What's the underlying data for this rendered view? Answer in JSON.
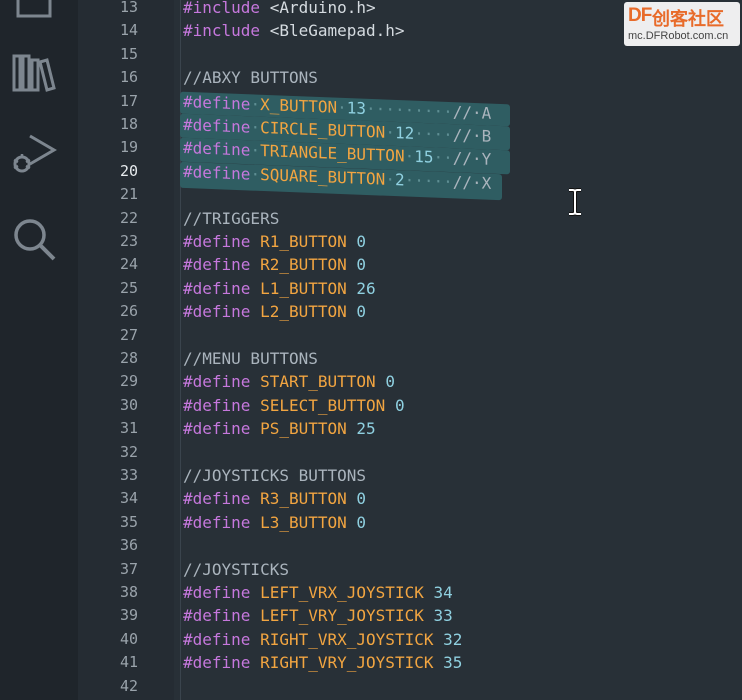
{
  "activity_bar": {
    "icons": [
      "explorer-icon",
      "library-icon",
      "run-debug-icon",
      "search-icon"
    ]
  },
  "gutter": {
    "line_numbers": [
      "13",
      "14",
      "15",
      "16",
      "17",
      "18",
      "19",
      "20",
      "21",
      "22",
      "23",
      "24",
      "25",
      "26",
      "27",
      "28",
      "29",
      "30",
      "31",
      "32",
      "33",
      "34",
      "35",
      "36",
      "37",
      "38",
      "39",
      "40",
      "41",
      "42"
    ],
    "active_line": "20"
  },
  "code": {
    "lines": [
      [
        [
          "kw",
          "#include"
        ],
        [
          "str",
          " <Arduino.h>"
        ]
      ],
      [
        [
          "kw",
          "#include"
        ],
        [
          "str",
          " <BleGamepad.h>"
        ]
      ],
      [],
      [
        [
          "cmt",
          "//ABXY BUTTONS"
        ]
      ],
      [
        [
          "kw",
          "#define"
        ],
        [
          "ws",
          "·"
        ],
        [
          "mac",
          "X_BUTTON"
        ],
        [
          "ws",
          "·"
        ],
        [
          "num",
          "13"
        ],
        [
          "ws",
          "·········"
        ],
        [
          "cmt",
          "//·A"
        ]
      ],
      [
        [
          "kw",
          "#define"
        ],
        [
          "ws",
          "·"
        ],
        [
          "mac",
          "CIRCLE_BUTTON"
        ],
        [
          "ws",
          "·"
        ],
        [
          "num",
          "12"
        ],
        [
          "ws",
          "····"
        ],
        [
          "cmt",
          "//·B"
        ]
      ],
      [
        [
          "kw",
          "#define"
        ],
        [
          "ws",
          "·"
        ],
        [
          "mac",
          "TRIANGLE_BUTTON"
        ],
        [
          "ws",
          "·"
        ],
        [
          "num",
          "15"
        ],
        [
          "ws",
          "··"
        ],
        [
          "cmt",
          "//·Y"
        ]
      ],
      [
        [
          "kw",
          "#define"
        ],
        [
          "ws",
          "·"
        ],
        [
          "mac",
          "SQUARE_BUTTON"
        ],
        [
          "ws",
          "·"
        ],
        [
          "num",
          "2"
        ],
        [
          "ws",
          "·····"
        ],
        [
          "cmt",
          "//·X"
        ]
      ],
      [],
      [
        [
          "cmt",
          "//TRIGGERS"
        ]
      ],
      [
        [
          "kw",
          "#define"
        ],
        [
          "str",
          " "
        ],
        [
          "mac",
          "R1_BUTTON"
        ],
        [
          "str",
          " "
        ],
        [
          "num",
          "0"
        ]
      ],
      [
        [
          "kw",
          "#define"
        ],
        [
          "str",
          " "
        ],
        [
          "mac",
          "R2_BUTTON"
        ],
        [
          "str",
          " "
        ],
        [
          "num",
          "0"
        ]
      ],
      [
        [
          "kw",
          "#define"
        ],
        [
          "str",
          " "
        ],
        [
          "mac",
          "L1_BUTTON"
        ],
        [
          "str",
          " "
        ],
        [
          "num",
          "26"
        ]
      ],
      [
        [
          "kw",
          "#define"
        ],
        [
          "str",
          " "
        ],
        [
          "mac",
          "L2_BUTTON"
        ],
        [
          "str",
          " "
        ],
        [
          "num",
          "0"
        ]
      ],
      [],
      [
        [
          "cmt",
          "//MENU BUTTONS"
        ]
      ],
      [
        [
          "kw",
          "#define"
        ],
        [
          "str",
          " "
        ],
        [
          "mac",
          "START_BUTTON"
        ],
        [
          "str",
          " "
        ],
        [
          "num",
          "0"
        ]
      ],
      [
        [
          "kw",
          "#define"
        ],
        [
          "str",
          " "
        ],
        [
          "mac",
          "SELECT_BUTTON"
        ],
        [
          "str",
          " "
        ],
        [
          "num",
          "0"
        ]
      ],
      [
        [
          "kw",
          "#define"
        ],
        [
          "str",
          " "
        ],
        [
          "mac",
          "PS_BUTTON"
        ],
        [
          "str",
          " "
        ],
        [
          "num",
          "25"
        ]
      ],
      [],
      [
        [
          "cmt",
          "//JOYSTICKS BUTTONS"
        ]
      ],
      [
        [
          "kw",
          "#define"
        ],
        [
          "str",
          " "
        ],
        [
          "mac",
          "R3_BUTTON"
        ],
        [
          "str",
          " "
        ],
        [
          "num",
          "0"
        ]
      ],
      [
        [
          "kw",
          "#define"
        ],
        [
          "str",
          " "
        ],
        [
          "mac",
          "L3_BUTTON"
        ],
        [
          "str",
          " "
        ],
        [
          "num",
          "0"
        ]
      ],
      [],
      [
        [
          "cmt",
          "//JOYSTICKS"
        ]
      ],
      [
        [
          "kw",
          "#define"
        ],
        [
          "str",
          " "
        ],
        [
          "mac",
          "LEFT_VRX_JOYSTICK"
        ],
        [
          "str",
          " "
        ],
        [
          "num",
          "34"
        ]
      ],
      [
        [
          "kw",
          "#define"
        ],
        [
          "str",
          " "
        ],
        [
          "mac",
          "LEFT_VRY_JOYSTICK"
        ],
        [
          "str",
          " "
        ],
        [
          "num",
          "33"
        ]
      ],
      [
        [
          "kw",
          "#define"
        ],
        [
          "str",
          " "
        ],
        [
          "mac",
          "RIGHT_VRX_JOYSTICK"
        ],
        [
          "str",
          " "
        ],
        [
          "num",
          "32"
        ]
      ],
      [
        [
          "kw",
          "#define"
        ],
        [
          "str",
          " "
        ],
        [
          "mac",
          "RIGHT_VRY_JOYSTICK"
        ],
        [
          "str",
          " "
        ],
        [
          "num",
          "35"
        ]
      ],
      []
    ]
  },
  "watermark": {
    "logo": "DF",
    "name": "创客社区",
    "url": "mc.DFRobot.com.cn"
  }
}
